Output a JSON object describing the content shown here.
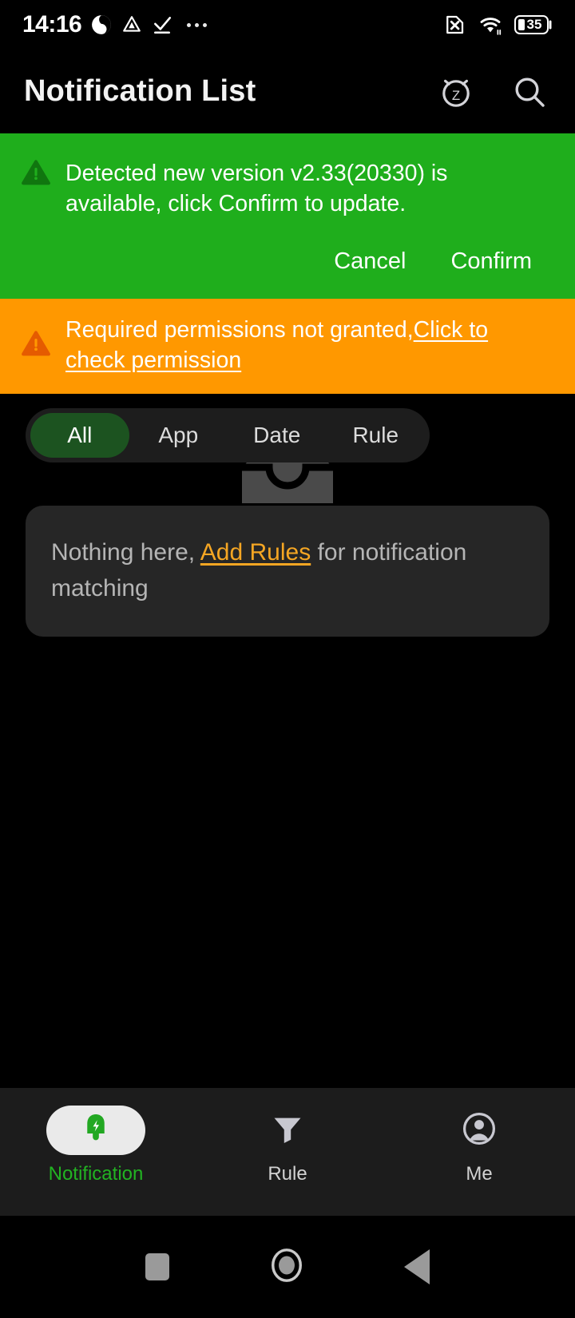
{
  "status_bar": {
    "time": "14:16",
    "battery_level": "35",
    "icons": [
      "app-badge-icon",
      "triangle-app-icon",
      "check-download-icon",
      "more-dots-icon",
      "no-sim-icon",
      "wifi-icon",
      "battery-icon"
    ]
  },
  "app_bar": {
    "title": "Notification List",
    "actions": [
      {
        "name": "snooze-alarm-icon",
        "label": "Snooze"
      },
      {
        "name": "search-icon",
        "label": "Search"
      }
    ]
  },
  "update_banner": {
    "icon": "warning-triangle-icon",
    "message": "Detected new version v2.33(20330) is available, click Confirm to update.",
    "cancel_label": "Cancel",
    "confirm_label": "Confirm",
    "bg_color": "#1fae1c"
  },
  "permission_banner": {
    "icon": "warning-triangle-icon",
    "message": "Required permissions not granted,",
    "link_text": "Click to check permission",
    "bg_color": "#ff9800"
  },
  "tabs": {
    "items": [
      {
        "label": "All",
        "active": true
      },
      {
        "label": "App",
        "active": false
      },
      {
        "label": "Date",
        "active": false
      },
      {
        "label": "Rule",
        "active": false
      }
    ]
  },
  "empty_state": {
    "illustration": "empty-inbox-icon",
    "text_before": "Nothing here, ",
    "link_text": "Add Rules",
    "text_after": " for notification matching"
  },
  "bottom_nav": {
    "items": [
      {
        "label": "Notification",
        "icon": "bell-lightning-icon",
        "active": true
      },
      {
        "label": "Rule",
        "icon": "filter-funnel-icon",
        "active": false
      },
      {
        "label": "Me",
        "icon": "account-circle-icon",
        "active": false
      }
    ],
    "active_color": "#22b322"
  },
  "android_nav": {
    "items": [
      {
        "name": "recents-button"
      },
      {
        "name": "home-button"
      },
      {
        "name": "back-button"
      }
    ]
  }
}
